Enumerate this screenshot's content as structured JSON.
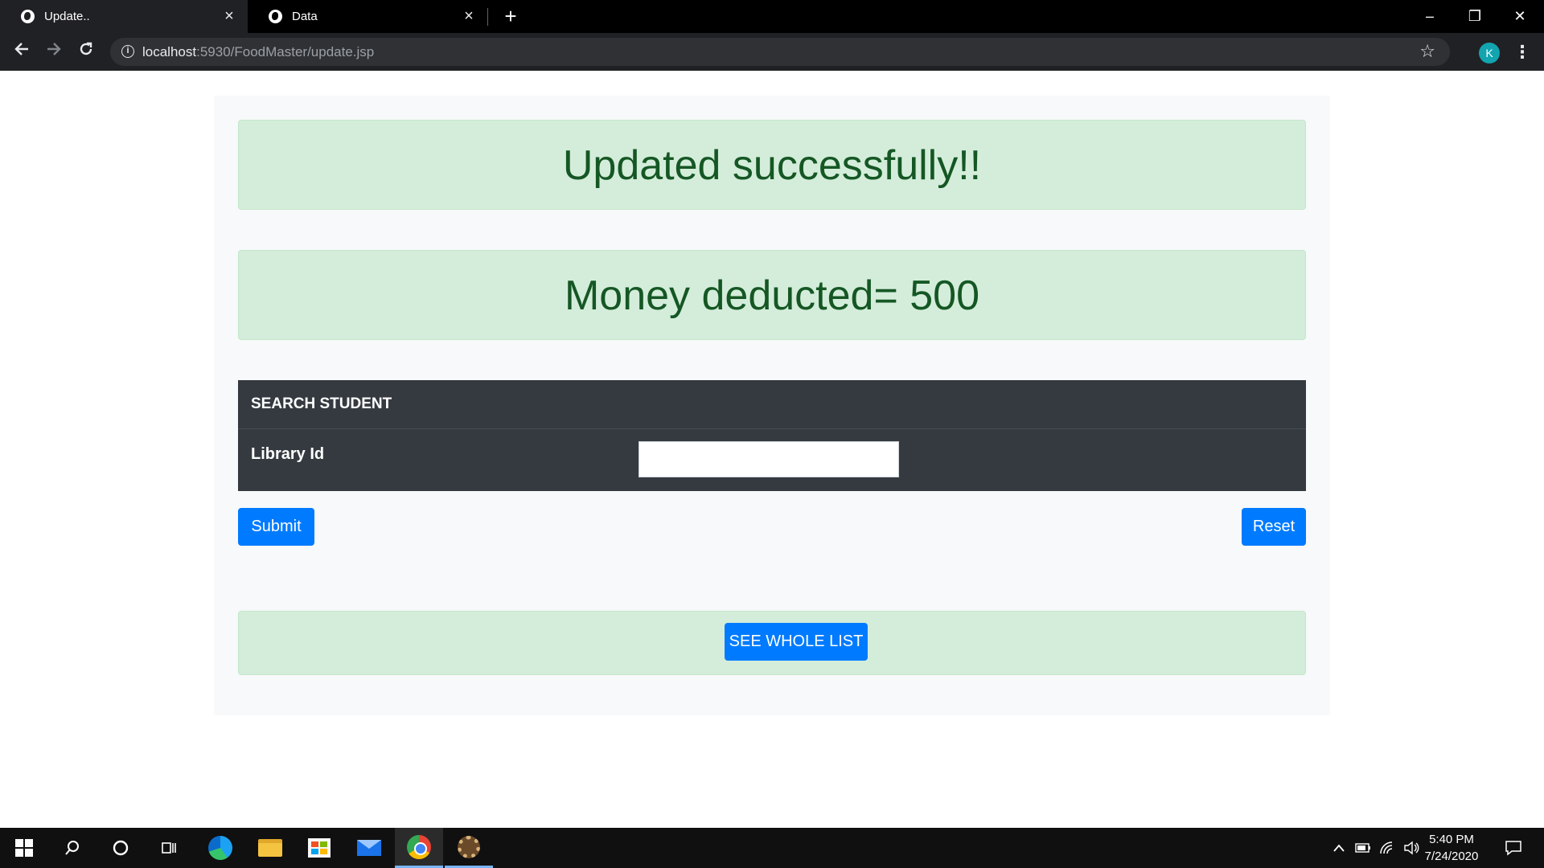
{
  "browser": {
    "tabs": [
      {
        "title": "Update..",
        "active": true
      },
      {
        "title": "Data",
        "active": false
      }
    ],
    "new_tab": "+",
    "url_host": "localhost",
    "url_rest": ":5930/FoodMaster/update.jsp",
    "profile_initial": "K",
    "window_controls": {
      "minimize": "–",
      "restore": "❐",
      "close": "✕"
    }
  },
  "page": {
    "success_message": "Updated successfully!!",
    "deduction_message": "Money deducted= 500",
    "search": {
      "heading": "SEARCH STUDENT",
      "field_label": "Library Id",
      "field_value": "",
      "field_placeholder": ""
    },
    "buttons": {
      "submit": "Submit",
      "reset": "Reset",
      "see_list": "SEE WHOLE LIST"
    }
  },
  "taskbar": {
    "time": "5:40 PM",
    "date": "7/24/2020",
    "active_app": "chrome"
  },
  "colors": {
    "alert_bg": "#d4edda",
    "alert_text": "#155724",
    "primary": "#007bff",
    "table_dark": "#343a40"
  }
}
